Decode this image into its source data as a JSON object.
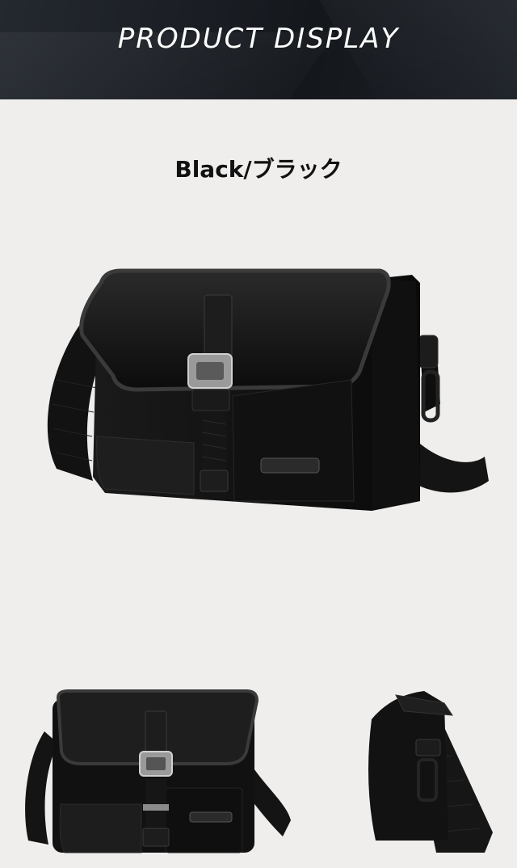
{
  "header": {
    "title": "PRODUCT DISPLAY"
  },
  "product": {
    "color_label": "Black/ブラック"
  },
  "images": [
    {
      "name": "main-photo",
      "view": "three-quarter"
    },
    {
      "name": "front-photo",
      "view": "front"
    },
    {
      "name": "side-photo",
      "view": "side"
    }
  ],
  "colors": {
    "header_bg": "#1b1f25",
    "page_bg": "#efeeec",
    "bag": "#141414"
  }
}
